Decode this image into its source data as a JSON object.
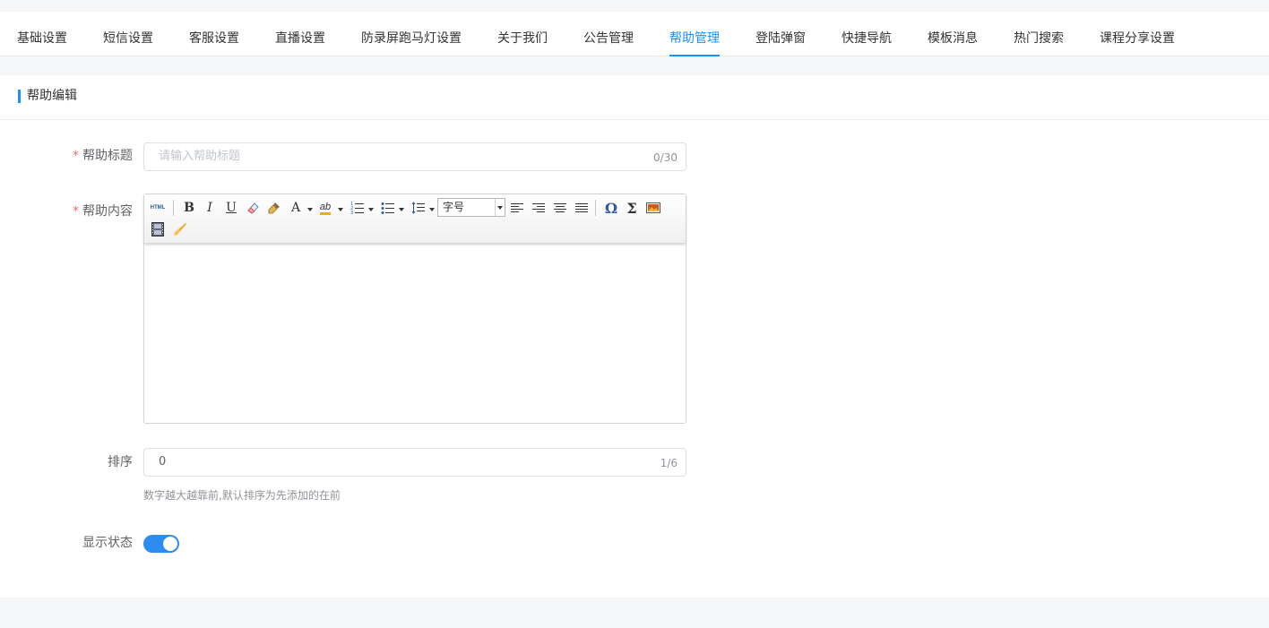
{
  "tabs": [
    {
      "label": "基础设置"
    },
    {
      "label": "短信设置"
    },
    {
      "label": "客服设置"
    },
    {
      "label": "直播设置"
    },
    {
      "label": "防录屏跑马灯设置"
    },
    {
      "label": "关于我们"
    },
    {
      "label": "公告管理"
    },
    {
      "label": "帮助管理",
      "active": true
    },
    {
      "label": "登陆弹窗"
    },
    {
      "label": "快捷导航"
    },
    {
      "label": "模板消息"
    },
    {
      "label": "热门搜索"
    },
    {
      "label": "课程分享设置"
    }
  ],
  "accent_color": "#1890ff",
  "card": {
    "title": "帮助编辑"
  },
  "form": {
    "title_field": {
      "label": "帮助标题",
      "required_mark": "*",
      "placeholder": "请输入帮助标题",
      "value": "",
      "counter": "0/30"
    },
    "content_field": {
      "label": "帮助内容",
      "required_mark": "*",
      "toolbar": {
        "html_label": "HTML",
        "bold": "B",
        "italic": "I",
        "underline": "U",
        "font_color": "A",
        "highlight": "ab",
        "font_size_placeholder": "字号",
        "icons": [
          "html-icon",
          "bold-icon",
          "italic-icon",
          "underline-icon",
          "eraser-icon",
          "format-brush-icon",
          "font-color-icon",
          "highlight-icon",
          "ordered-list-icon",
          "unordered-list-icon",
          "line-height-icon",
          "align-left-icon",
          "align-right-icon",
          "align-center-icon",
          "justify-icon",
          "omega-icon",
          "sigma-icon",
          "image-icon",
          "video-icon",
          "brush-icon"
        ]
      },
      "body": ""
    },
    "sort_field": {
      "label": "排序",
      "value": "0",
      "counter": "1/6",
      "hint": "数字越大越靠前,默认排序为先添加的在前"
    },
    "status_field": {
      "label": "显示状态",
      "enabled": true
    }
  }
}
